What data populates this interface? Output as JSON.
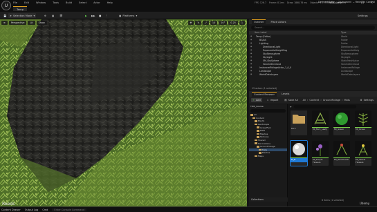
{
  "app": {
    "window_title": "TWS_Course",
    "tab": "Temp"
  },
  "menu": [
    "File",
    "Edit",
    "Window",
    "Tools",
    "Build",
    "Select",
    "Actor",
    "Help"
  ],
  "stats": [
    "FPS: 126.7",
    "Frame: 8.1ms",
    "Draw: 1868.76 ms",
    "Objects: 47,173",
    "GPU: 29.65ms"
  ],
  "toolbar": {
    "mode": "Selection Mode",
    "platforms": "Platforms",
    "settings": "Settings"
  },
  "viewport": {
    "perspective": "Perspective",
    "lit": "Lit",
    "show": "Show",
    "snap_value": "10",
    "angle_value": "10°",
    "scale_value": "0.25",
    "speed_value": "1"
  },
  "outliner": {
    "tabs": [
      "Outliner",
      "Place Actors"
    ],
    "search_placeholder": "Search...",
    "columns": [
      "Item Label",
      "Type"
    ],
    "rows": [
      {
        "label": "Temp (Editor)",
        "type": "World",
        "indent": 0
      },
      {
        "label": "BG/AS",
        "type": "Folder",
        "indent": 1
      },
      {
        "label": "Lighting",
        "type": "Folder",
        "indent": 1
      },
      {
        "label": "DirectionalLight",
        "type": "DirectionalLight",
        "indent": 2
      },
      {
        "label": "ExponentialHeightFog",
        "type": "ExponentialHeig",
        "indent": 2
      },
      {
        "label": "SkyAtmosphere",
        "type": "SkyAtmosphere",
        "indent": 2
      },
      {
        "label": "SkyLight",
        "type": "SkyLight",
        "indent": 2
      },
      {
        "label": "SM_SkySphere",
        "type": "StaticMeshActor",
        "indent": 2
      },
      {
        "label": "VolumetricCloud",
        "type": "VolumetricCloud",
        "indent": 2
      },
      {
        "label": "InstancedFoliageActor_1_0_0",
        "type": "InstancedFoliage",
        "indent": 1
      },
      {
        "label": "Landscape",
        "type": "Landscape",
        "indent": 1
      },
      {
        "label": "WorldDataLayers",
        "type": "WorldDataLayers",
        "indent": 1
      }
    ],
    "footer": "15 actors (1 selected)"
  },
  "content_browser": {
    "tabs": [
      "Content Browser",
      "Levels"
    ],
    "add": "Add",
    "import": "Import",
    "save_all": "Save All",
    "breadcrumb": [
      "All",
      "Content",
      "GroundFoliage",
      "Mats"
    ],
    "settings": "Settings",
    "sources_title": "TWS_Course",
    "sources": [
      {
        "label": "All",
        "indent": 0
      },
      {
        "label": "Content",
        "indent": 1
      },
      {
        "label": "BG/AS",
        "indent": 2
      },
      {
        "label": "Landscape",
        "indent": 2
      },
      {
        "label": "Grass/Fern",
        "indent": 3
      },
      {
        "label": "Mats",
        "indent": 3
      },
      {
        "label": "Meshes",
        "indent": 3
      },
      {
        "label": "Textures",
        "indent": 3
      },
      {
        "label": "Shared",
        "indent": 2
      },
      {
        "label": "Decorations",
        "indent": 2
      },
      {
        "label": "GroundFoliage",
        "indent": 3
      },
      {
        "label": "Mats",
        "indent": 4
      },
      {
        "label": "Meshes",
        "indent": 4
      },
      {
        "label": "Maps",
        "indent": 2
      }
    ],
    "assets": [
      {
        "label": "Fern",
        "kind": "folder"
      },
      {
        "label": "MI_Fern_Leafy",
        "kind": "fern"
      },
      {
        "label": "MI_Green",
        "kind": "sphere"
      },
      {
        "label": "MI_Grass",
        "kind": "fern2"
      },
      {
        "label": "M_B",
        "kind": "sel"
      },
      {
        "label": "MI_Purple Flowers",
        "kind": "flower"
      },
      {
        "label": "MI_Red Flower",
        "kind": "fern3"
      },
      {
        "label": "MI_Yellow Flowers",
        "kind": "fern4"
      }
    ],
    "collections": "Collections",
    "status": "8 items (1 selected)"
  },
  "statusbar": {
    "items": [
      "Content Drawer",
      "Output Log",
      "Cmd"
    ],
    "cmd_placeholder": "Enter Console Command",
    "right": [
      "Derived Data",
      "2 Unsaved",
      "Revision Control"
    ]
  },
  "watermark": "Reeds",
  "watermark_right": "Udemy",
  "colors": {
    "accent": "#e0a020",
    "selection": "#2e4a6a",
    "play": "#5fbf4a"
  }
}
